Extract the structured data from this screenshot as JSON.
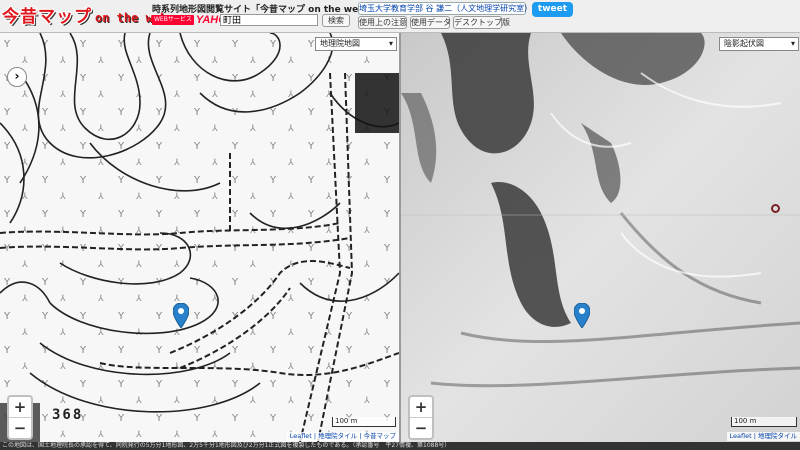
{
  "header": {
    "logo_jp": "今昔マップ",
    "logo_en": "on the web",
    "site_title": "時系列地形図閲覧サイト「今昔マップ on the web」",
    "yahoo_badge": "WEBサービス",
    "yahoo_label": "YAHOO!",
    "search_value": "町田",
    "search_button": "検索",
    "author_link": "埼玉大学教育学部 谷 謙二（人文地理学研究室）",
    "notice_button": "使用上の注意",
    "data_button": "使用データ",
    "desktop_button": "デスクトップ版",
    "tweet_button": "tweet"
  },
  "left_map": {
    "layer": "地理院地図",
    "side_button": "›",
    "zoom_in": "+",
    "zoom_out": "−",
    "scale_label": "100 m",
    "attribution": [
      "Leaflet",
      "地理院タイル",
      "今昔マップ"
    ],
    "map_number": "368"
  },
  "right_map": {
    "layer": "陰影起伏図",
    "zoom_in": "+",
    "zoom_out": "−",
    "scale_label": "100 m",
    "attribution": [
      "Leaflet",
      "地理院タイル"
    ]
  },
  "footer": {
    "text": "この地図は、国土地理院長の承認を得て、同院発行の5万分1地形図、2万5千分1地形図及び2万分1正式図を複製したものである。（承認番号　平27情複、第1088号）"
  },
  "colors": {
    "tweet": "#1d9bf0",
    "logo": "#e0161d",
    "marker": "#2a81cb"
  }
}
